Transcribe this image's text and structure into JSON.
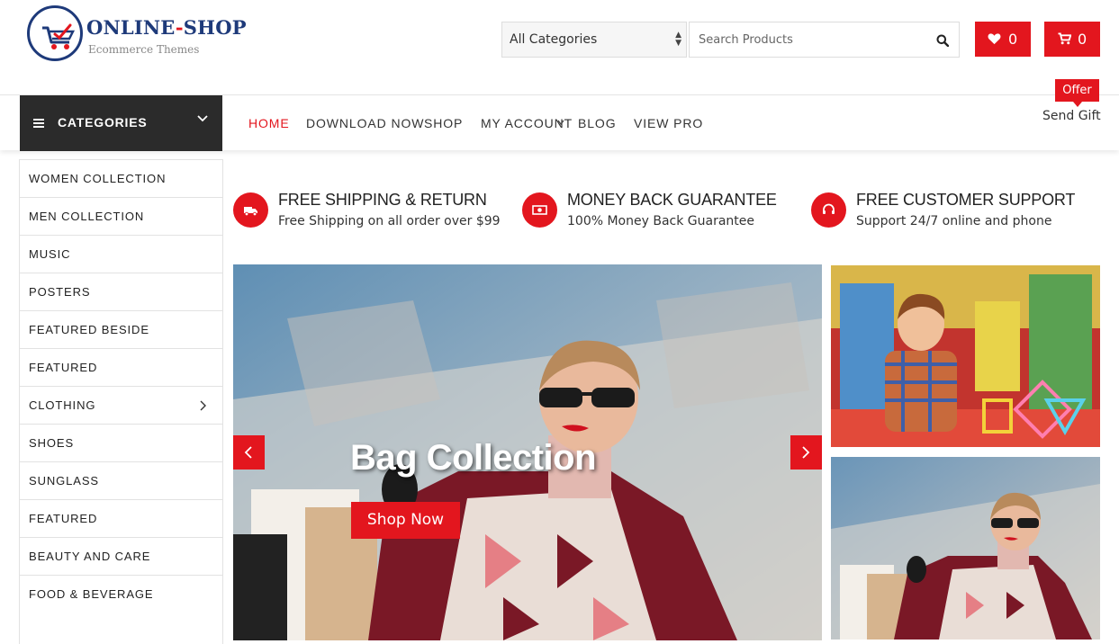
{
  "brand": {
    "name_left": "ONLINE",
    "name_dash": "-",
    "name_right": "SHOP",
    "tagline": "Ecommerce Themes"
  },
  "header": {
    "category_select": "All Categories",
    "search_placeholder": "Search Products",
    "wishlist_count": "0",
    "cart_count": "0"
  },
  "nav": {
    "categories_label": "CATEGORIES",
    "items": [
      {
        "label": "HOME",
        "active": true
      },
      {
        "label": "DOWNLOAD NOW"
      },
      {
        "label": "SHOP"
      },
      {
        "label": "MY ACCOUNT"
      },
      {
        "label": "BLOG"
      },
      {
        "label": "VIEW PRO"
      }
    ],
    "offer_badge": "Offer",
    "gift_label": "Send Gift"
  },
  "sidebar": {
    "items": [
      {
        "label": "WOMEN COLLECTION"
      },
      {
        "label": "MEN COLLECTION"
      },
      {
        "label": "MUSIC"
      },
      {
        "label": "POSTERS"
      },
      {
        "label": "FEATURED BESIDE"
      },
      {
        "label": "FEATURED"
      },
      {
        "label": "CLOTHING"
      },
      {
        "label": "SHOES"
      },
      {
        "label": "SUNGLASS"
      },
      {
        "label": "FEATURED"
      },
      {
        "label": "BEAUTY AND CARE"
      },
      {
        "label": "FOOD & BEVERAGE"
      }
    ]
  },
  "features": [
    {
      "title": "FREE SHIPPING & RETURN",
      "subtitle": "Free Shipping on all order over $99",
      "icon": "truck-icon"
    },
    {
      "title": "MONEY BACK GUARANTEE",
      "subtitle": "100% Money Back Guarantee",
      "icon": "money-icon"
    },
    {
      "title": "FREE CUSTOMER SUPPORT",
      "subtitle": "Support 24/7 online and phone",
      "icon": "headset-icon"
    }
  ],
  "slider": {
    "title": "Bag Collection",
    "button": "Shop Now"
  },
  "colors": {
    "accent": "#e3161e",
    "dark": "#2b2b2b",
    "brand_blue": "#1e3a7a"
  }
}
